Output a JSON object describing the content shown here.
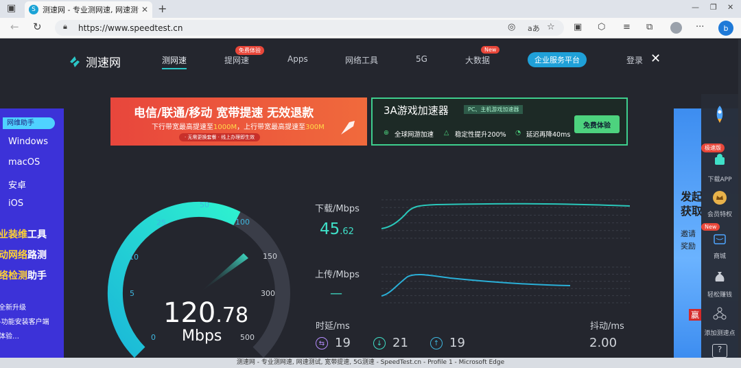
{
  "browser": {
    "tab_title": "测速网 - 专业测网速, 网速测试",
    "url": "https://www.speedtest.cn",
    "status": "测速网 - 专业测网速, 网速测试, 宽带提速, 5G测速 - SpeedTest.cn - Profile 1 - Microsoft Edge",
    "reader_label": "aあ"
  },
  "site": {
    "logo_text": "测速网",
    "nav": [
      {
        "label": "测网速",
        "active": true
      },
      {
        "label": "提网速",
        "badge": "免费体验"
      },
      {
        "label": "Apps"
      },
      {
        "label": "网络工具"
      },
      {
        "label": "5G"
      },
      {
        "label": "大数据",
        "badge": "New"
      }
    ],
    "enterprise_button": "企业服务平台",
    "login": "登录"
  },
  "ads": {
    "left": {
      "headline": "电信/联通/移动 宽带提速 无效退款",
      "sub_pre": "下行带宽最高提速至",
      "sub_down": "1000M",
      "sub_mid": "，上行带宽最高提速至",
      "sub_up": "300M",
      "pill": "· 无需更换套餐 · 线上办理即生效"
    },
    "right": {
      "headline": "3A游戏加速器",
      "tag": "PC、主机游戏加速器",
      "features": [
        "全球网游加速",
        "稳定性提升200%",
        "延迟再降40ms"
      ],
      "button": "免费体验"
    }
  },
  "left_panel": {
    "header": "网维助手",
    "os": [
      "Windows",
      "macOS",
      "安卓",
      "iOS"
    ],
    "tag_lines": [
      {
        "pre": "业装维",
        "hl": "",
        "post": "工具"
      },
      {
        "pre": "动",
        "hl": "网络",
        "post": "路测"
      },
      {
        "pre": "络",
        "hl": "检测",
        "post": "助手"
      }
    ],
    "small_lines": [
      "全新升级",
      "-功能安装客户端",
      "体验…"
    ]
  },
  "right_panel": {
    "title_lines": [
      "发起",
      "获取"
    ],
    "sub_lines": [
      "邀请",
      "奖励"
    ],
    "tail": "赢"
  },
  "sidebar": {
    "items": [
      {
        "label": "下载APP",
        "badge": "极速版"
      },
      {
        "label": "会员特权"
      },
      {
        "label": "商城",
        "badge": "New"
      },
      {
        "label": "轻松赚钱"
      },
      {
        "label": "添加测速点"
      }
    ]
  },
  "gauge": {
    "value_int": "120",
    "value_dec": ".78",
    "unit": "Mbps",
    "ticks": [
      "0",
      "5",
      "10",
      "25",
      "50",
      "100",
      "150",
      "300",
      "500"
    ],
    "fill_fraction": 0.6
  },
  "results": {
    "download_label": "下载/Mbps",
    "download_int": "45",
    "download_dec": ".62",
    "upload_label": "上传/Mbps",
    "upload_value": "—",
    "latency_label": "时延/ms",
    "latency_values": [
      "19",
      "21",
      "19"
    ],
    "jitter_label": "抖动/ms",
    "jitter_value": "2.00"
  },
  "colors": {
    "accent": "#2bc6c6",
    "value": "#3fe0c8",
    "brand_blue": "#1fa0d8"
  }
}
